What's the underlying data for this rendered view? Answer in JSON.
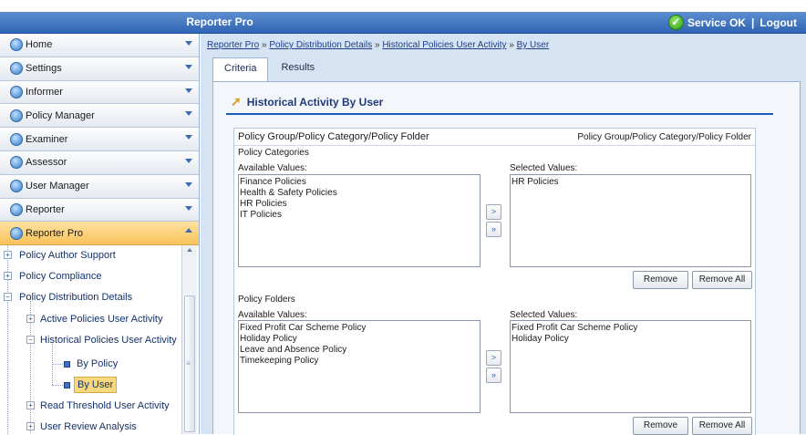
{
  "app": {
    "title": "Reporter Pro",
    "status_text": "Service OK",
    "separator": "|",
    "logout": "Logout"
  },
  "sidebar": {
    "menu": [
      {
        "label": "Home"
      },
      {
        "label": "Settings"
      },
      {
        "label": "Informer"
      },
      {
        "label": "Policy Manager"
      },
      {
        "label": "Examiner"
      },
      {
        "label": "Assessor"
      },
      {
        "label": "User Manager"
      },
      {
        "label": "Reporter"
      },
      {
        "label": "Reporter Pro"
      }
    ],
    "tree": [
      {
        "label": "Policy Author Support"
      },
      {
        "label": "Policy Compliance"
      },
      {
        "label": "Policy Distribution Details"
      },
      {
        "label": "Active Policies User Activity"
      },
      {
        "label": "Historical Policies User Activity"
      },
      {
        "label": "By Policy"
      },
      {
        "label": "By User"
      },
      {
        "label": "Read Threshold User Activity"
      },
      {
        "label": "User Review Analysis"
      }
    ]
  },
  "breadcrumb": {
    "sep": "»",
    "items": [
      "Reporter Pro",
      "Policy Distribution Details",
      "Historical Policies User Activity",
      "By User"
    ]
  },
  "tabs": [
    {
      "label": "Criteria"
    },
    {
      "label": "Results"
    }
  ],
  "panel": {
    "title": "Historical Activity By User"
  },
  "form": {
    "header_left": "Policy Group/Policy Category/Policy Folder",
    "header_right": "Policy Group/Policy Category/Policy Folder",
    "categories": {
      "title": "Policy Categories",
      "available_label": "Available Values:",
      "selected_label": "Selected Values:",
      "available": [
        "Finance Policies",
        "Health & Safety Policies",
        "HR Policies",
        "IT Policies"
      ],
      "selected": [
        "HR Policies"
      ],
      "add": ">",
      "add_all": "»",
      "remove": "Remove",
      "remove_all": "Remove All"
    },
    "folders": {
      "title": "Policy Folders",
      "available_label": "Available Values:",
      "selected_label": "Selected Values:",
      "available": [
        "Fixed Profit Car Scheme Policy",
        "Holiday Policy",
        "Leave and Absence Policy",
        "Timekeeping Policy"
      ],
      "selected": [
        "Fixed Profit Car Scheme Policy",
        "Holiday Policy"
      ],
      "add": ">",
      "add_all": "»",
      "remove": "Remove",
      "remove_all": "Remove All"
    }
  },
  "colors": {
    "titlebar": "#2f64b3",
    "active_menu": "#f9c25a",
    "rule": "#1d5dbd",
    "panel": "#d6e3f3"
  }
}
